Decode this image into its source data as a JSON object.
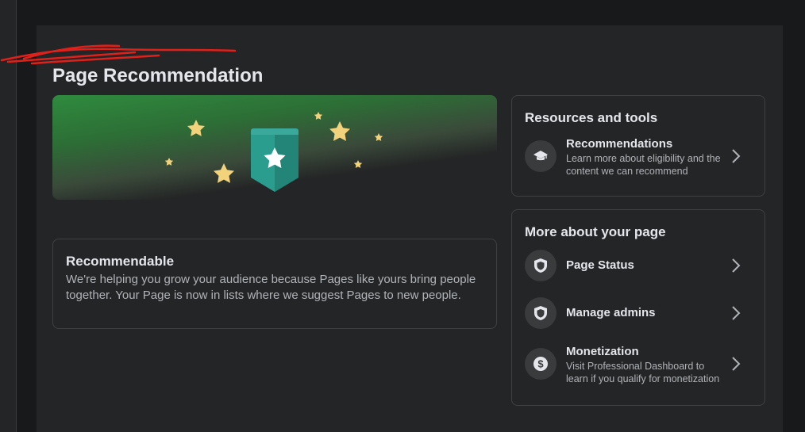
{
  "page": {
    "title": "Page Recommendation"
  },
  "recommendable": {
    "title": "Recommendable",
    "description": "We're helping you grow your audience because Pages like yours bring people together. Your Page is now in lists where we suggest Pages to new people."
  },
  "resources": {
    "heading": "Resources and tools",
    "items": [
      {
        "title": "Recommendations",
        "subtitle": "Learn more about eligibility and the content we can recommend",
        "icon": "graduation-cap-icon"
      }
    ]
  },
  "about": {
    "heading": "More about your page",
    "items": [
      {
        "title": "Page Status",
        "icon": "shield-icon"
      },
      {
        "title": "Manage admins",
        "icon": "shield-icon"
      },
      {
        "title": "Monetization",
        "subtitle": "Visit Professional Dashboard to learn if you qualify for monetization",
        "icon": "dollar-icon"
      }
    ]
  },
  "colors": {
    "background": "#18191a",
    "card": "#242526",
    "border": "#3e4042",
    "banner_green": "#2e8b3e",
    "star": "#f2d27a",
    "badge_teal": "#2a9d8f",
    "scribble": "#e0201a"
  }
}
